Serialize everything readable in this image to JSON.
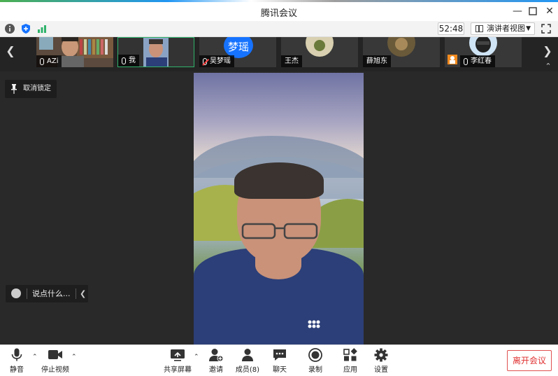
{
  "window": {
    "title": "腾讯会议"
  },
  "infobar": {
    "timer": "52:48",
    "view_mode": "演讲者视图"
  },
  "participants": [
    {
      "name": "AZi",
      "mic": "on"
    },
    {
      "name": "我",
      "mic": "on",
      "active": true
    },
    {
      "name": "吴梦瑶",
      "mic": "muted",
      "avatar_text": "梦瑶"
    },
    {
      "name": "王杰",
      "mic": "none"
    },
    {
      "name": "薛旭东",
      "mic": "none"
    },
    {
      "name": "李红春",
      "mic": "on"
    }
  ],
  "main": {
    "unpin_label": "取消锁定",
    "chat_placeholder": "说点什么..."
  },
  "toolbar": {
    "mute": "静音",
    "stop_video": "停止视频",
    "share_screen": "共享屏幕",
    "invite": "邀请",
    "members": "成员(8)",
    "chat": "聊天",
    "record": "录制",
    "apps": "应用",
    "settings": "设置",
    "leave": "离开会议"
  },
  "colors": {
    "accent_blue": "#1673ff",
    "active_green": "#2fb36b",
    "leave_red": "#e03030"
  }
}
